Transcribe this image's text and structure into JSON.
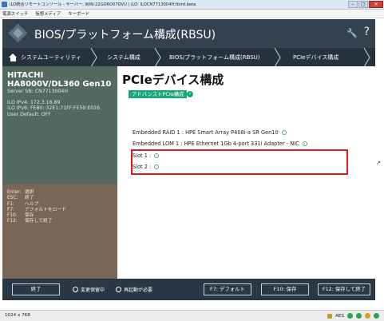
{
  "window": {
    "title": "iLO統合リモートコンソール - サーバー: WIN-22GO6O07DVU | iLO: ILOCN7713004H.tbird.beta",
    "minimize": "–",
    "maximize": "□",
    "close": "✕"
  },
  "menubar": {
    "items": [
      "電源スイッチ",
      "仮想メディア",
      "キーボード"
    ]
  },
  "header": {
    "title": "BIOS/プラットフォーム構成(RBSU)",
    "help": "?"
  },
  "breadcrumb": {
    "items": [
      "システムユーティリティ",
      "システム構成",
      "BIOS/プラットフォーム構成(RBSU)",
      "PCIeデバイス構成"
    ]
  },
  "server": {
    "vendor": "HITACHI",
    "model": "HA8000V/DL360 Gen10",
    "serial": "Server SN: CN7713004H",
    "ipv4": "iLO IPv4: 172.3.16.89",
    "ipv6": "iLO IPv6: FE80::32E1:71FF:FE59:E026",
    "user_default": "User Default: OFF"
  },
  "keys": [
    {
      "key": "Enter:",
      "desc": "選択"
    },
    {
      "key": "ESC:",
      "desc": "終了"
    },
    {
      "key": "F1:",
      "desc": "ヘルプ"
    },
    {
      "key": "F7:",
      "desc": "デフォルトをロード"
    },
    {
      "key": "F10:",
      "desc": "保存"
    },
    {
      "key": "F12:",
      "desc": "保存して終了"
    }
  ],
  "main": {
    "title": "PCIeデバイス構成",
    "advanced_badge": "アドバンストPCIe構成",
    "devices": [
      "Embedded RAID 1 : HPE Smart Array P408i-a SR Gen10",
      "Embedded LOM 1 : HPE Ethernet 1Gb 4-port 331i Adapter - NIC",
      "Slot 1 :",
      "Slot 2 :"
    ]
  },
  "footer": {
    "exit": "終了",
    "pending": "変更保留中",
    "reboot": "再起動が必要",
    "f7": "F7: デフォルト",
    "f10": "F10: 保存",
    "f12": "F12: 保存して終了"
  },
  "statusbar": {
    "resolution": "1024 x 768",
    "encryption": "AES"
  },
  "colors": {
    "accent_green": "#19a77c",
    "highlight_red": "#e0191f",
    "sidebar_top": "#546a60",
    "sidebar_bottom": "#7a6656",
    "header": "#34414e"
  }
}
